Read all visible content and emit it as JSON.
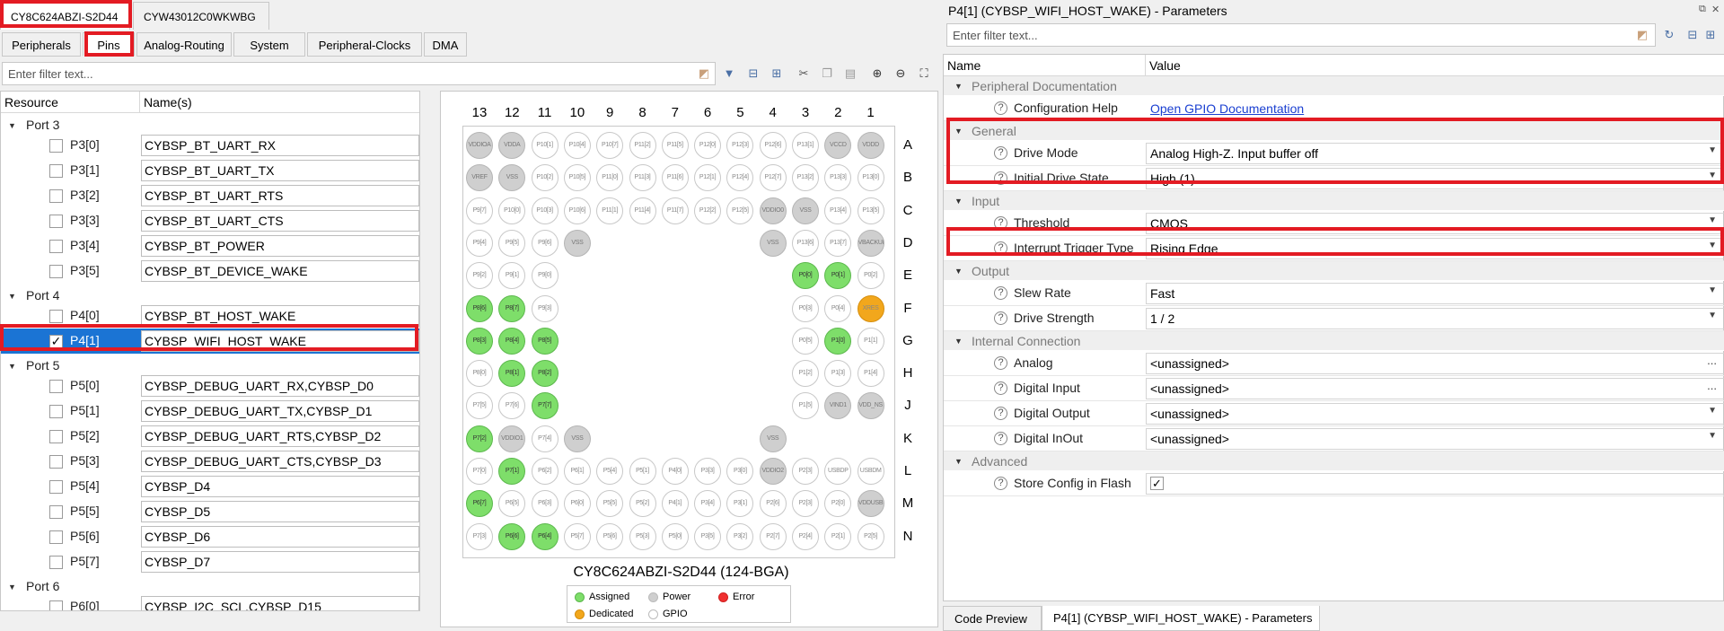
{
  "device_tabs": [
    "CY8C624ABZI-S2D44",
    "CYW43012C0WKWBG"
  ],
  "left_tabs": [
    "Peripherals",
    "Pins",
    "Analog-Routing",
    "System",
    "Peripheral-Clocks",
    "DMA"
  ],
  "left_filter_placeholder": "Enter filter text...",
  "pin_table": {
    "col_resource": "Resource",
    "col_names": "Name(s)",
    "rows": [
      {
        "kind": "port",
        "label": "Port 3"
      },
      {
        "kind": "pin",
        "pin": "P3[0]",
        "name": "CYBSP_BT_UART_RX",
        "checked": false
      },
      {
        "kind": "pin",
        "pin": "P3[1]",
        "name": "CYBSP_BT_UART_TX",
        "checked": false
      },
      {
        "kind": "pin",
        "pin": "P3[2]",
        "name": "CYBSP_BT_UART_RTS",
        "checked": false
      },
      {
        "kind": "pin",
        "pin": "P3[3]",
        "name": "CYBSP_BT_UART_CTS",
        "checked": false
      },
      {
        "kind": "pin",
        "pin": "P3[4]",
        "name": "CYBSP_BT_POWER",
        "checked": false
      },
      {
        "kind": "pin",
        "pin": "P3[5]",
        "name": "CYBSP_BT_DEVICE_WAKE",
        "checked": false
      },
      {
        "kind": "port",
        "label": "Port 4"
      },
      {
        "kind": "pin",
        "pin": "P4[0]",
        "name": "CYBSP_BT_HOST_WAKE",
        "checked": false
      },
      {
        "kind": "pin",
        "pin": "P4[1]",
        "name": "CYBSP_WIFI_HOST_WAKE",
        "checked": true,
        "selected": true
      },
      {
        "kind": "port",
        "label": "Port 5"
      },
      {
        "kind": "pin",
        "pin": "P5[0]",
        "name": "CYBSP_DEBUG_UART_RX,CYBSP_D0",
        "checked": false
      },
      {
        "kind": "pin",
        "pin": "P5[1]",
        "name": "CYBSP_DEBUG_UART_TX,CYBSP_D1",
        "checked": false
      },
      {
        "kind": "pin",
        "pin": "P5[2]",
        "name": "CYBSP_DEBUG_UART_RTS,CYBSP_D2",
        "checked": false
      },
      {
        "kind": "pin",
        "pin": "P5[3]",
        "name": "CYBSP_DEBUG_UART_CTS,CYBSP_D3",
        "checked": false
      },
      {
        "kind": "pin",
        "pin": "P5[4]",
        "name": "CYBSP_D4",
        "checked": false
      },
      {
        "kind": "pin",
        "pin": "P5[5]",
        "name": "CYBSP_D5",
        "checked": false
      },
      {
        "kind": "pin",
        "pin": "P5[6]",
        "name": "CYBSP_D6",
        "checked": false
      },
      {
        "kind": "pin",
        "pin": "P5[7]",
        "name": "CYBSP_D7",
        "checked": false
      },
      {
        "kind": "port",
        "label": "Port 6"
      },
      {
        "kind": "pin",
        "pin": "P6[0]",
        "name": "CYBSP_I2C_SCL,CYBSP_D15",
        "checked": false
      }
    ]
  },
  "package": {
    "title": "CY8C624ABZI-S2D44 (124-BGA)",
    "columns": [
      "13",
      "12",
      "11",
      "10",
      "9",
      "8",
      "7",
      "6",
      "5",
      "4",
      "3",
      "2",
      "1"
    ],
    "rows": [
      "A",
      "B",
      "C",
      "D",
      "E",
      "F",
      "G",
      "H",
      "J",
      "K",
      "L",
      "M",
      "N"
    ],
    "cells": [
      [
        "VDDIOA|p",
        "VDDA|p",
        "P10[1]",
        "P10[4]",
        "P10[7]",
        "P11[2]",
        "P11[5]",
        "P12[0]",
        "P12[3]",
        "P12[6]",
        "P13[1]",
        "VCCD|p",
        "VDDD|p"
      ],
      [
        "VREF|p",
        "VSS|p",
        "P10[2]",
        "P10[5]",
        "P11[0]",
        "P11[3]",
        "P11[6]",
        "P12[1]",
        "P12[4]",
        "P12[7]",
        "P13[2]",
        "P13[3]",
        "P13[0]"
      ],
      [
        "P9[7]",
        "P10[0]",
        "P10[3]",
        "P10[6]",
        "P11[1]",
        "P11[4]",
        "P11[7]",
        "P12[2]",
        "P12[5]",
        "VDDIO0|p",
        "VSS|p",
        "P13[4]",
        "P13[5]"
      ],
      [
        "P9[4]",
        "P9[5]",
        "P9[6]",
        "VSS|p",
        "",
        "",
        "",
        "",
        "",
        "VSS|p",
        "P13[6]",
        "P13[7]",
        "VBACKUP|p"
      ],
      [
        "P9[2]",
        "P9[1]",
        "P9[0]",
        "",
        "",
        "",
        "",
        "",
        "",
        "",
        "P0[0]|g",
        "P0[1]|g",
        "P0[2]"
      ],
      [
        "P8[6]|g",
        "P8[7]|g",
        "P9[3]",
        "",
        "",
        "",
        "",
        "",
        "",
        "",
        "P0[3]",
        "P0[4]",
        "XRES|o"
      ],
      [
        "P8[3]|g",
        "P8[4]|g",
        "P8[5]|g",
        "",
        "",
        "",
        "",
        "",
        "",
        "",
        "P0[5]",
        "P1[0]|g",
        "P1[1]"
      ],
      [
        "P8[0]",
        "P8[1]|g",
        "P8[2]|g",
        "",
        "",
        "",
        "",
        "",
        "",
        "",
        "P1[2]",
        "P1[3]",
        "P1[4]"
      ],
      [
        "P7[5]",
        "P7[6]",
        "P7[7]|g",
        "",
        "",
        "",
        "",
        "",
        "",
        "",
        "P1[5]",
        "VIND1|p",
        "VDD_NS|p"
      ],
      [
        "P7[2]|g",
        "VDDIO1|p",
        "P7[4]",
        "VSS|p",
        "",
        "",
        "",
        "",
        "",
        "VSS|p",
        "",
        "",
        ""
      ],
      [
        "P7[0]",
        "P7[1]|g",
        "P6[2]",
        "P6[1]",
        "P5[4]",
        "P5[1]",
        "P4[0]",
        "P3[3]",
        "P3[0]",
        "VDDIO2|p",
        "P2[3]",
        "USBDP",
        "USBDM"
      ],
      [
        "P6[7]|g",
        "P6[5]",
        "P6[3]",
        "P6[0]",
        "P5[5]",
        "P5[2]",
        "P4[1]|s",
        "P3[4]",
        "P3[1]",
        "P2[6]",
        "P2[3]",
        "P2[0]",
        "VDDUSB|p"
      ],
      [
        "P7[3]",
        "P6[6]|g",
        "P6[4]|g",
        "P5[7]",
        "P5[6]",
        "P5[3]",
        "P5[0]",
        "P3[5]",
        "P3[2]",
        "P2[7]",
        "P2[4]",
        "P2[1]",
        "P2[5]"
      ]
    ],
    "legend": {
      "assigned": "Assigned",
      "power": "Power",
      "error": "Error",
      "dedicated": "Dedicated",
      "gpio": "GPIO"
    }
  },
  "params_panel": {
    "title": "P4[1] (CYBSP_WIFI_HOST_WAKE) - Parameters",
    "filter_placeholder": "Enter filter text...",
    "col_name": "Name",
    "col_value": "Value",
    "entries": [
      {
        "kind": "group",
        "label": "Peripheral Documentation"
      },
      {
        "kind": "param",
        "name": "Configuration Help",
        "value": "Open GPIO Documentation",
        "link": true
      },
      {
        "kind": "group",
        "label": "General"
      },
      {
        "kind": "param",
        "name": "Drive Mode",
        "value": "Analog High-Z. Input buffer off",
        "dropdown": true
      },
      {
        "kind": "param",
        "name": "Initial Drive State",
        "value": "High (1)",
        "dropdown": true
      },
      {
        "kind": "group",
        "label": "Input"
      },
      {
        "kind": "param",
        "name": "Threshold",
        "value": "CMOS",
        "dropdown": true
      },
      {
        "kind": "param",
        "name": "Interrupt Trigger Type",
        "value": "Rising Edge",
        "dropdown": true
      },
      {
        "kind": "group",
        "label": "Output"
      },
      {
        "kind": "param",
        "name": "Slew Rate",
        "value": "Fast",
        "dropdown": true
      },
      {
        "kind": "param",
        "name": "Drive Strength",
        "value": "1 / 2",
        "dropdown": true
      },
      {
        "kind": "group",
        "label": "Internal Connection"
      },
      {
        "kind": "param",
        "name": "Analog",
        "value": "<unassigned>",
        "ellipsis": true
      },
      {
        "kind": "param",
        "name": "Digital Input",
        "value": "<unassigned>",
        "ellipsis": true
      },
      {
        "kind": "param",
        "name": "Digital Output",
        "value": "<unassigned>",
        "dropdown": true
      },
      {
        "kind": "param",
        "name": "Digital InOut",
        "value": "<unassigned>",
        "dropdown": true
      },
      {
        "kind": "group",
        "label": "Advanced"
      },
      {
        "kind": "param",
        "name": "Store Config in Flash",
        "value": "",
        "checkbox": true
      }
    ]
  },
  "bottom_tabs": [
    "Code Preview",
    "P4[1] (CYBSP_WIFI_HOST_WAKE) - Parameters"
  ],
  "colors": {
    "selection": "#1b74d4",
    "highlight": "#e31b23",
    "assigned": "#7ede6a",
    "dedicated": "#f2a71c",
    "power": "#cfcfcf"
  }
}
